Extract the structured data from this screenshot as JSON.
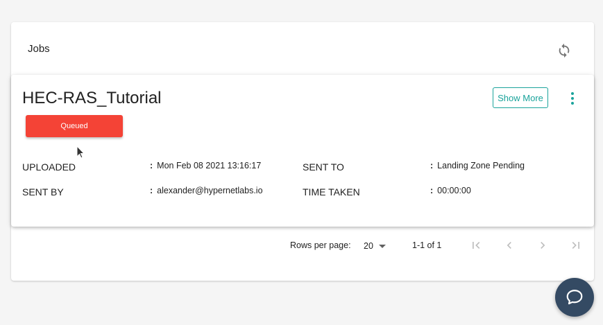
{
  "panel": {
    "title": "Jobs",
    "refresh_icon": "refresh-icon"
  },
  "job": {
    "name": "HEC-RAS_Tutorial",
    "show_more_label": "Show More",
    "status": "Queued",
    "colors": {
      "status": "#f44336",
      "accent": "#1aa39b"
    },
    "fields": {
      "uploaded_label": "UPLOADED",
      "uploaded_value": "Mon Feb 08 2021 13:16:17",
      "sent_by_label": "SENT BY",
      "sent_by_value": "alexander@hypernetlabs.io",
      "sent_to_label": "SENT TO",
      "sent_to_value": "Landing Zone Pending",
      "time_taken_label": "TIME TAKEN",
      "time_taken_value": "00:00:00"
    }
  },
  "pagination": {
    "rows_per_page_label": "Rows per page:",
    "rows_per_page_value": "20",
    "range": "1-1 of 1"
  },
  "chat": {
    "icon": "chat-bubble-icon",
    "color": "#344a63"
  }
}
